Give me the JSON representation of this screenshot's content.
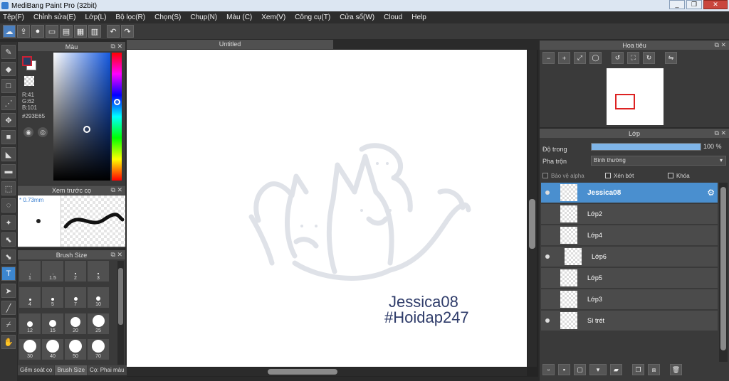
{
  "title": "MediBang Paint Pro (32bit)",
  "menu": [
    "Tệp(F)",
    "Chỉnh sửa(E)",
    "Lớp(L)",
    "Bộ lọc(R)",
    "Chọn(S)",
    "Chụp(N)",
    "Màu (C)",
    "Xem(V)",
    "Công cụ(T)",
    "Cửa sổ(W)",
    "Cloud",
    "Help"
  ],
  "color_panel": {
    "title": "Màu",
    "r": "R:41",
    "g": "G:62",
    "b": "B:101",
    "hex": "#293E65",
    "fg_color": "#293E65"
  },
  "brush_preview": {
    "title": "Xem trước cọ",
    "size": "* 0.73mm"
  },
  "brush_size": {
    "title": "Brush Size",
    "sizes": [
      "1",
      "1.5",
      "2",
      "3",
      "4",
      "5",
      "7",
      "10",
      "12",
      "15",
      "20",
      "25",
      "30",
      "40",
      "50",
      "70"
    ],
    "tabs": [
      "Gểm soát cọ",
      "Brush Size",
      "Cọ: Phai màu"
    ]
  },
  "canvas": {
    "tab": "Untitled",
    "watermark_line1": "Jessica08",
    "watermark_line2": "#Hoidap247"
  },
  "navigator": {
    "title": "Hoa tiêu"
  },
  "layers": {
    "title": "Lớp",
    "opacity_label": "Độ trong",
    "opacity_value": "100 %",
    "blend_label": "Pha trộn",
    "blend_value": "Bình thường",
    "protect_alpha": "Bảo vệ alpha",
    "clipping": "Xén bớt",
    "lock": "Khóa",
    "items": [
      {
        "name": "Jessica08",
        "selected": true,
        "visible": true
      },
      {
        "name": "Lớp2",
        "selected": false,
        "visible": false
      },
      {
        "name": "Lớp4",
        "selected": false,
        "visible": false
      },
      {
        "name": "Lớp6",
        "selected": false,
        "visible": true
      },
      {
        "name": "Lớp5",
        "selected": false,
        "visible": false
      },
      {
        "name": "Lớp3",
        "selected": false,
        "visible": false
      },
      {
        "name": "Sì trét",
        "selected": false,
        "visible": true
      }
    ]
  },
  "window_buttons": {
    "minimize": "_",
    "restore": "❐",
    "close": "✕"
  }
}
